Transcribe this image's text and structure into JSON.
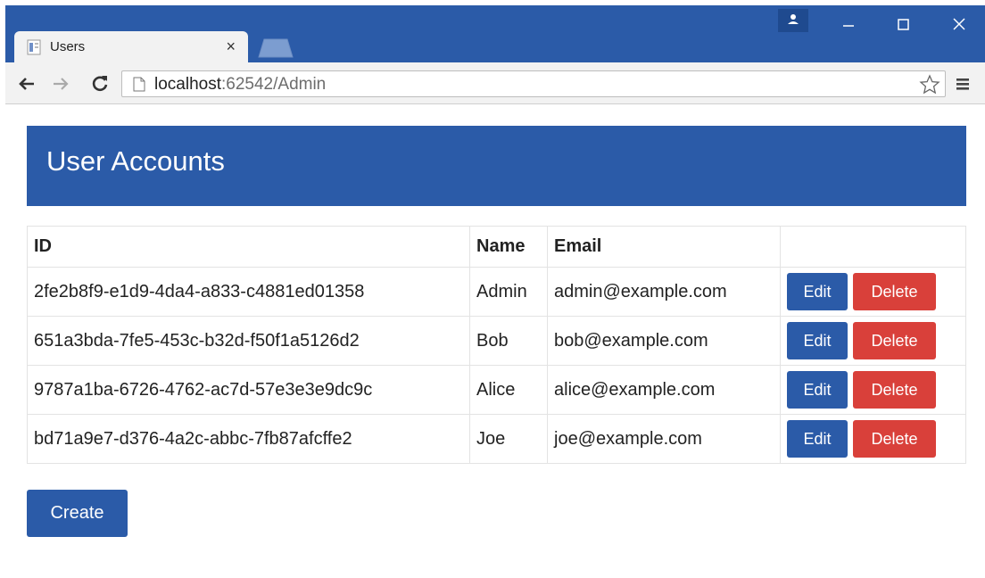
{
  "browser": {
    "tab_title": "Users",
    "tab_close": "×",
    "url_host": "localhost",
    "url_path": ":62542/Admin"
  },
  "page": {
    "heading": "User Accounts",
    "table": {
      "headers": [
        "ID",
        "Name",
        "Email",
        ""
      ],
      "rows": [
        {
          "id": "2fe2b8f9-e1d9-4da4-a833-c4881ed01358",
          "name": "Admin",
          "email": "admin@example.com"
        },
        {
          "id": "651a3bda-7fe5-453c-b32d-f50f1a5126d2",
          "name": "Bob",
          "email": "bob@example.com"
        },
        {
          "id": "9787a1ba-6726-4762-ac7d-57e3e3e9dc9c",
          "name": "Alice",
          "email": "alice@example.com"
        },
        {
          "id": "bd71a9e7-d376-4a2c-abbc-7fb87afcffe2",
          "name": "Joe",
          "email": "joe@example.com"
        }
      ],
      "edit_label": "Edit",
      "delete_label": "Delete"
    },
    "create_label": "Create"
  },
  "icons": {
    "back": "arrow-left-icon",
    "forward": "arrow-right-icon",
    "reload": "reload-icon",
    "page": "page-icon",
    "star": "star-icon",
    "menu": "hamburger-menu-icon"
  },
  "colors": {
    "primary": "#2b5ba8",
    "danger": "#d9403a",
    "chrome": "#2b5ba8"
  }
}
